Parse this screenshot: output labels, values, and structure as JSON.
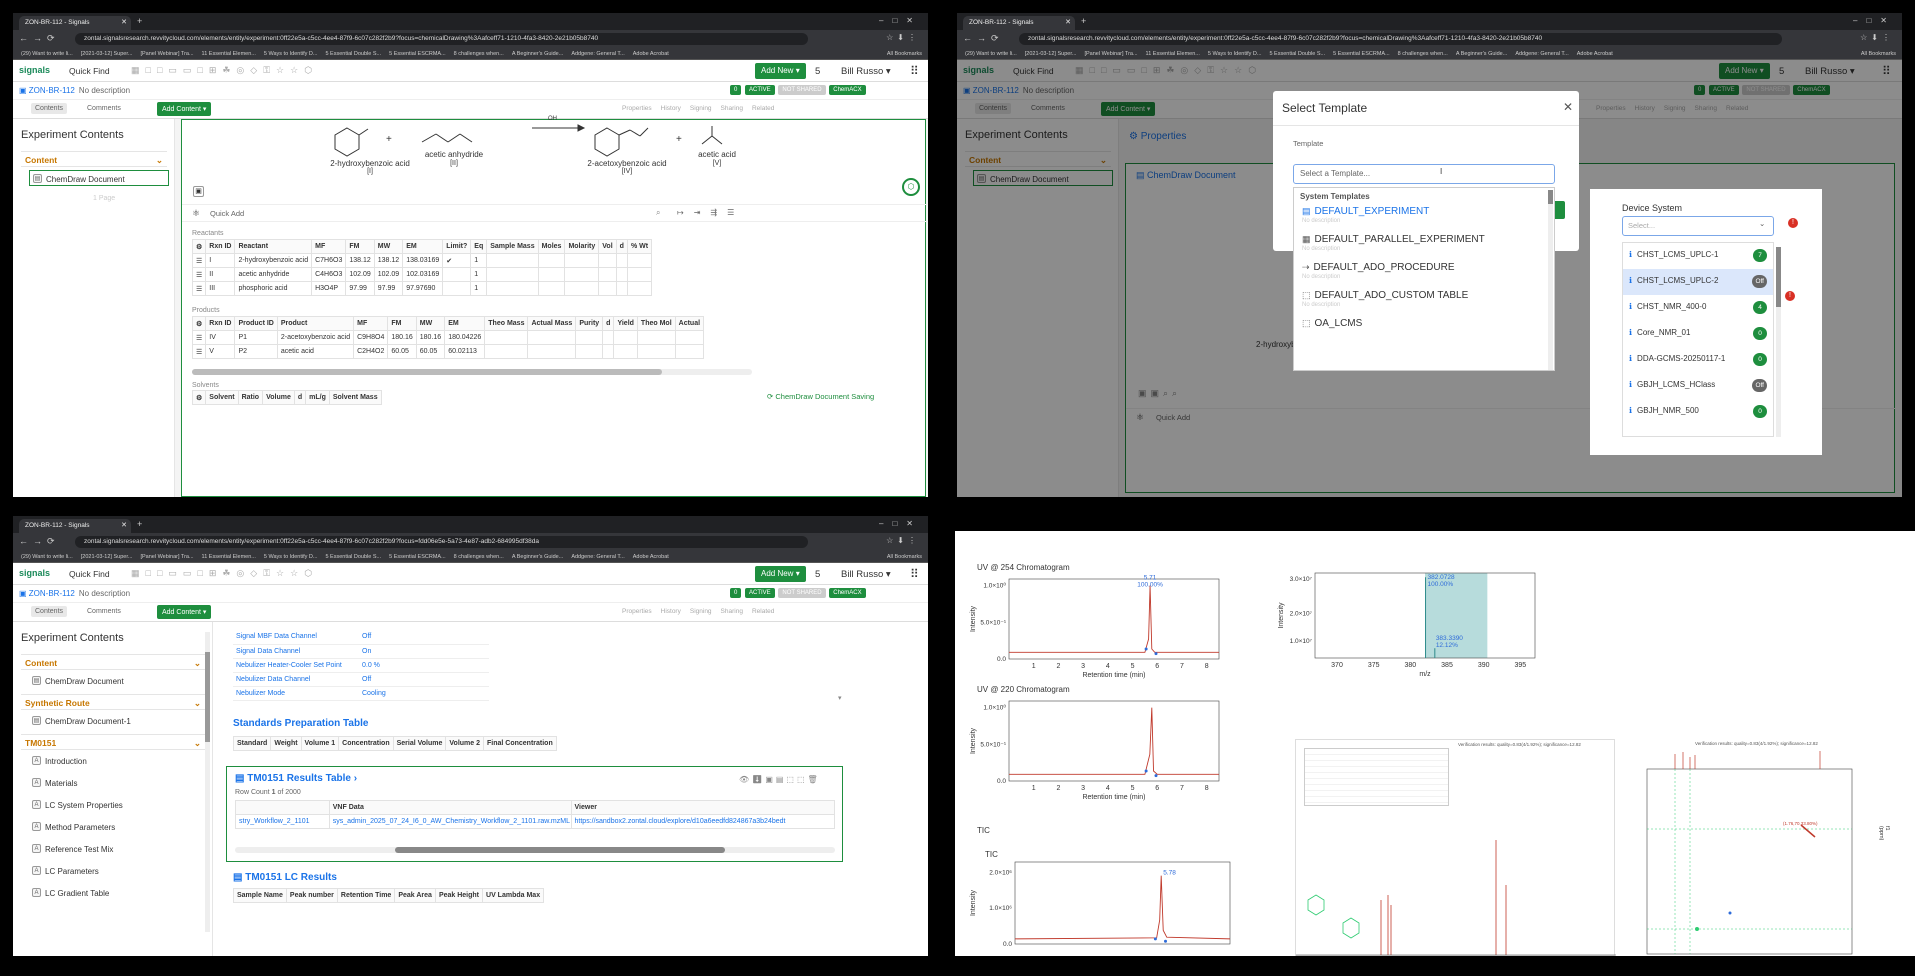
{
  "browser": {
    "tab_title": "ZON-BR-112 - Signals",
    "url_q1": "zontal.signalsresearch.revvitycloud.com/elements/entity/experiment:0ff22e5a-c5cc-4ee4-87f9-6c07c282f2b9?focus=chemicalDrawing%3Aafceff71-1210-4fa3-8420-2e21b05b8740",
    "url_q3": "zontal.signalsresearch.revvitycloud.com/elements/entity/experiment:0ff22e5a-c5cc-4ee4-87f9-6c07c282f2b9?focus=fdd06e5e-5a73-4e87-adb2-684995df38da",
    "bookmarks": [
      "(29) Want to write li...",
      "[2021-03-12] Super...",
      "[Panel Webinar] Tra...",
      "11 Essential Elemen...",
      "5 Ways to Identify D...",
      "5 Essential Double S...",
      "5 Essential ESCRMA...",
      "8 challenges when...",
      "A Beginner's Guide...",
      "Addgene: General T...",
      "Adobe Acrobat"
    ],
    "all_bookmarks": "All Bookmarks"
  },
  "app": {
    "logo": "signals",
    "quick_find": "Quick Find",
    "add_new": "Add New",
    "notif": "5",
    "user": "Bill Russo",
    "experiment_id": "ZON-BR-112",
    "no_description": "No description",
    "badge_count": "0",
    "active": "ACTIVE",
    "not_shared": "NOT SHARED",
    "chemack": "ChemACX",
    "contents_tab": "Contents",
    "comments_tab": "Comments",
    "add_content": "Add Content",
    "right_tabs": [
      "Properties",
      "History",
      "Signing",
      "Sharing",
      "Related"
    ],
    "experiment_contents": "Experiment Contents"
  },
  "q1": {
    "sidebar": {
      "section": "Content",
      "item": "ChemDraw Document",
      "page": "1 Page"
    },
    "reaction": {
      "r1": "2-hydroxybenzoic acid",
      "r1_id": "[I]",
      "r2": "acetic anhydride",
      "r2_id": "[II]",
      "p1": "2-acetoxybenzoic acid",
      "p1_id": "[IV]",
      "p2": "acetic acid",
      "p2_id": "[V]",
      "arrow_label": "OH"
    },
    "quick_add": "Quick Add",
    "reactants_label": "Reactants",
    "reactant_headers": [
      "Rxn ID",
      "Reactant",
      "MF",
      "FM",
      "MW",
      "EM",
      "Limit?",
      "Eq",
      "Sample Mass",
      "Moles",
      "Molarity",
      "Vol",
      "d",
      "% Wt"
    ],
    "reactants": [
      [
        "I",
        "2-hydroxybenzoic acid",
        "C7H6O3",
        "138.12",
        "138.12",
        "138.03169",
        "✔",
        "1",
        "",
        "",
        "",
        "",
        "",
        ""
      ],
      [
        "II",
        "acetic anhydride",
        "C4H6O3",
        "102.09",
        "102.09",
        "102.03169",
        "",
        "1",
        "",
        "",
        "",
        "",
        "",
        ""
      ],
      [
        "III",
        "phosphoric acid",
        "H3O4P",
        "97.99",
        "97.99",
        "97.97690",
        "",
        "1",
        "",
        "",
        "",
        "",
        "",
        ""
      ]
    ],
    "products_label": "Products",
    "product_headers": [
      "Rxn ID",
      "Product ID",
      "Product",
      "MF",
      "FM",
      "MW",
      "EM",
      "Theo Mass",
      "Actual Mass",
      "Purity",
      "d",
      "Yield",
      "Theo Mol",
      "Actual"
    ],
    "products": [
      [
        "IV",
        "P1",
        "2-acetoxybenzoic acid",
        "C9H8O4",
        "180.16",
        "180.16",
        "180.04226",
        "",
        "",
        "",
        "",
        "",
        "",
        ""
      ],
      [
        "V",
        "P2",
        "acetic acid",
        "C2H4O2",
        "60.05",
        "60.05",
        "60.02113",
        "",
        "",
        "",
        "",
        "",
        "",
        ""
      ]
    ],
    "solvents_label": "Solvents",
    "solvent_headers": [
      "Solvent",
      "Ratio",
      "Volume",
      "d",
      "mL/g",
      "Solvent Mass"
    ],
    "saving": "ChemDraw Document Saving"
  },
  "q2": {
    "sidebar": {
      "section": "Content",
      "item": "ChemDraw Document"
    },
    "properties": "Properties",
    "chemdraw_doc": "ChemDraw Document",
    "r1": "2-hydroxybenzoic acid",
    "r1_id": "[I]",
    "r2_id": "[II]",
    "p1_short": "2-ace",
    "quick_add": "Quick Add",
    "dialog": {
      "title": "Select Template",
      "template_label": "Template",
      "placeholder": "Select a Template...",
      "group": "System Templates",
      "no_desc": "No description",
      "options": [
        "DEFAULT_EXPERIMENT",
        "DEFAULT_PARALLEL_EXPERIMENT",
        "DEFAULT_ADO_PROCEDURE",
        "DEFAULT_ADO_CUSTOM TABLE",
        "OA_LCMS"
      ]
    },
    "device": {
      "title": "Device System",
      "placeholder": "Select...",
      "items": [
        {
          "name": "CHST_LCMS_UPLC-1",
          "badge": "7",
          "color": "#1e8e3e"
        },
        {
          "name": "CHST_LCMS_UPLC-2",
          "badge": "Off",
          "color": "#666666"
        },
        {
          "name": "CHST_NMR_400-0",
          "badge": "4",
          "color": "#1e8e3e"
        },
        {
          "name": "Core_NMR_01",
          "badge": "0",
          "color": "#1e8e3e"
        },
        {
          "name": "DDA-GCMS-20250117-1",
          "badge": "0",
          "color": "#1e8e3e"
        },
        {
          "name": "GBJH_LCMS_HClass",
          "badge": "Off",
          "color": "#666666"
        },
        {
          "name": "GBJH_NMR_500",
          "badge": "0",
          "color": "#1e8e3e"
        }
      ]
    }
  },
  "q3": {
    "sidebar": {
      "content": "Content",
      "chemdraw": "ChemDraw Document",
      "synthetic": "Synthetic Route",
      "chemdraw1": "ChemDraw Document-1",
      "tm": "TM0151",
      "tm_items": [
        "Introduction",
        "Materials",
        "LC System Properties",
        "Method Parameters",
        "Reference Test Mix",
        "LC Parameters",
        "LC Gradient Table"
      ]
    },
    "props": [
      [
        "Signal MBF Data Channel",
        "Off"
      ],
      [
        "Signal Data Channel",
        "On"
      ],
      [
        "Nebulizer Heater-Cooler Set Point",
        "0.0 %"
      ],
      [
        "Nebulizer Data Channel",
        "Off"
      ],
      [
        "Nebulizer Mode",
        "Cooling"
      ]
    ],
    "std_title": "Standards Preparation Table",
    "std_headers": [
      "Standard",
      "Weight",
      "Volume 1",
      "Concentration",
      "Serial Volume",
      "Volume 2",
      "Final Concentration"
    ],
    "results_title": "TM0151 Results Table",
    "row_count": "Row Count",
    "row_count_val": "1",
    "row_of": "of 2000",
    "results_headers": [
      "",
      "VNF Data",
      "Viewer"
    ],
    "results_row": [
      "stry_Workflow_2_1101",
      "sys_admin_2025_07_24_I6_0_AW_Chemistry_Workflow_2_1101.raw.mzML",
      "https://sandbox2.zontal.cloud/explore/d10a6eedfd824867a3b24bedt"
    ],
    "lc_title": "TM0151 LC Results",
    "lc_headers": [
      "Sample Name",
      "Peak number",
      "Retention Time",
      "Peak Area",
      "Peak Height",
      "UV Lambda Max"
    ]
  },
  "q4": {
    "uv254_title": "UV @ 254 Chromatogram",
    "uv220_title": "UV @ 220 Chromatogram",
    "tic_title": "TIC",
    "tic_sub": "TIC",
    "intensity": "Intensity",
    "rt_label": "Retention time (min)",
    "mz_label": "m/z",
    "peak254_rt": "5.71",
    "peak254_pct": "100.00%",
    "ms_peak1": "382.0728",
    "ms_peak1_pct": "100.00%",
    "ms_peak2": "383.3390",
    "ms_peak2_pct": "12.12%",
    "tic_peak": "5.78",
    "nmr_caption": "Verification results: quality=0.83(4/1.92%); significance=12.82",
    "ppm_label": "f1 (ppm)",
    "nmr_peak_label": "(1.76,70.33.80%)"
  },
  "chart_data": [
    {
      "type": "line",
      "title": "UV @ 254 Chromatogram",
      "xlabel": "Retention time (min)",
      "ylabel": "Intensity",
      "xlim": [
        0,
        8.5
      ],
      "ylim": [
        -0.1,
        1.1
      ],
      "x_ticks": [
        1,
        2,
        3,
        4,
        5,
        6,
        7,
        8
      ],
      "y_ticks": [
        "0.0",
        "5.0×10⁻¹",
        "1.0×10⁰"
      ],
      "series": [
        {
          "x": [
            0,
            5.5,
            5.65,
            5.71,
            5.78,
            5.9,
            8.5
          ],
          "y": [
            0,
            0,
            0.2,
            1.0,
            0.05,
            0,
            0
          ]
        }
      ]
    },
    {
      "type": "bar",
      "title": "",
      "xlabel": "m/z",
      "ylabel": "Intensity",
      "xlim": [
        367,
        397
      ],
      "x_ticks": [
        370,
        375,
        380,
        385,
        390,
        395
      ],
      "y_ticks": [
        "1.0×10⁷",
        "2.0×10⁷",
        "3.0×10⁷"
      ],
      "values": [
        {
          "x": 382.0728,
          "y": 1.0
        },
        {
          "x": 383.339,
          "y": 0.1212
        }
      ]
    },
    {
      "type": "line",
      "title": "UV @ 220 Chromatogram",
      "xlabel": "Retention time (min)",
      "ylabel": "Intensity",
      "xlim": [
        0,
        8.5
      ],
      "ylim": [
        -0.1,
        1.1
      ],
      "x_ticks": [
        1,
        2,
        3,
        4,
        5,
        6,
        7,
        8
      ],
      "y_ticks": [
        "0.0",
        "5.0×10⁻¹",
        "1.0×10⁰"
      ],
      "series": [
        {
          "x": [
            0,
            5.5,
            5.7,
            5.78,
            5.85,
            6.0,
            8.5
          ],
          "y": [
            0,
            0,
            0.3,
            1.0,
            0.05,
            0,
            0
          ]
        }
      ]
    },
    {
      "type": "line",
      "title": "TIC",
      "xlabel": "",
      "ylabel": "Intensity",
      "xlim": [
        0,
        8.5
      ],
      "ylim": [
        -0.1,
        2.3
      ],
      "y_ticks": [
        "0.0",
        "1.0×10⁶",
        "2.0×10⁶"
      ],
      "series": [
        {
          "x": [
            0,
            5.6,
            5.72,
            5.78,
            5.86,
            6.0,
            8.5
          ],
          "y": [
            0.05,
            0.08,
            0.6,
            1.9,
            0.3,
            0.1,
            0.05
          ]
        }
      ]
    }
  ]
}
